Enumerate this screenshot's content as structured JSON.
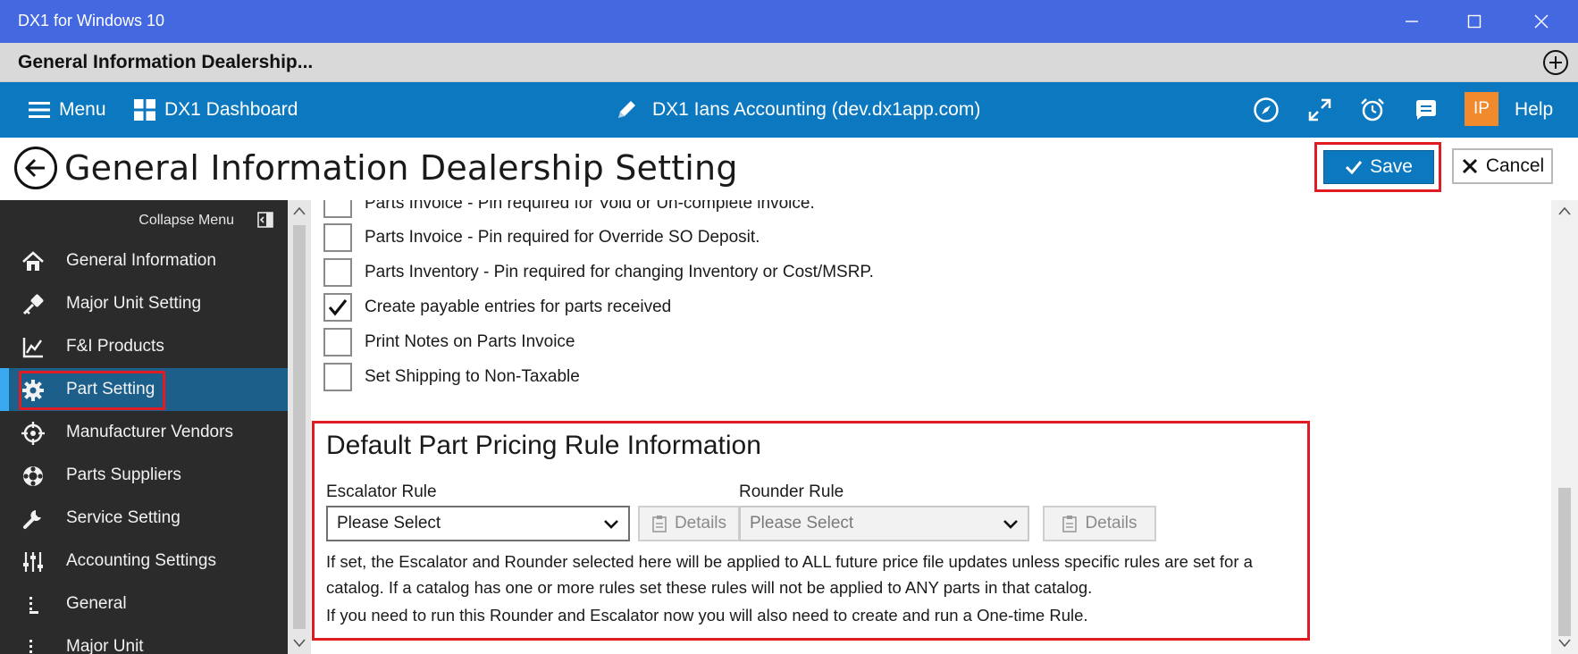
{
  "window": {
    "title": "DX1 for Windows 10",
    "minimize_icon": "minimize-icon",
    "maximize_icon": "maximize-icon",
    "close_icon": "close-icon"
  },
  "tab": {
    "title": "General Information Dealership...",
    "add_icon": "add-circle-icon"
  },
  "appbar": {
    "menu_label": "Menu",
    "dashboard_label": "DX1 Dashboard",
    "account_label": "DX1 Ians Accounting (dev.dx1app.com)",
    "avatar_initials": "IP",
    "help_label": "Help",
    "accent": "#0c78c0"
  },
  "page": {
    "title": "General Information Dealership Setting",
    "save_label": "Save",
    "cancel_label": "Cancel"
  },
  "sidebar": {
    "collapse_label": "Collapse Menu",
    "items": [
      {
        "label": "General Information",
        "icon": "home-icon",
        "active": false
      },
      {
        "label": "Major Unit Setting",
        "icon": "key-icon",
        "active": false
      },
      {
        "label": "F&I Products",
        "icon": "chart-icon",
        "active": false
      },
      {
        "label": "Part Setting",
        "icon": "gear-icon",
        "active": true
      },
      {
        "label": "Manufacturer Vendors",
        "icon": "crosshair-icon",
        "active": false
      },
      {
        "label": "Parts Suppliers",
        "icon": "lifebuoy-icon",
        "active": false
      },
      {
        "label": "Service Setting",
        "icon": "wrench-icon",
        "active": false
      },
      {
        "label": "Accounting Settings",
        "icon": "sliders-icon",
        "active": false
      },
      {
        "label": "General",
        "icon": "sub-item-icon",
        "active": false
      },
      {
        "label": "Major Unit",
        "icon": "sub-item-icon",
        "active": false
      }
    ]
  },
  "checkboxes": [
    {
      "label": "Parts Invoice - Pin required for Void or Un-complete invoice.",
      "checked": false
    },
    {
      "label": "Parts Invoice - Pin required for Override SO Deposit.",
      "checked": false
    },
    {
      "label": "Parts Inventory - Pin required for changing Inventory or Cost/MSRP.",
      "checked": false
    },
    {
      "label": "Create payable entries for parts received",
      "checked": true
    },
    {
      "label": "Print Notes on Parts Invoice",
      "checked": false
    },
    {
      "label": "Set Shipping to Non-Taxable",
      "checked": false
    }
  ],
  "pricing": {
    "title": "Default Part Pricing Rule Information",
    "escalator_label": "Escalator Rule",
    "escalator_value": "Please Select",
    "details_label": "Details",
    "rounder_label": "Rounder Rule",
    "rounder_value": "Please Select",
    "details2_label": "Details",
    "note1": "If set, the Escalator and Rounder selected here will be applied to ALL future price file updates unless specific rules are set for a catalog. If a catalog has one or more rules set these rules will not be applied to ANY parts in that catalog.",
    "note2": "If you need to run this Rounder and Escalator now you will also need to create and run a One-time Rule."
  }
}
